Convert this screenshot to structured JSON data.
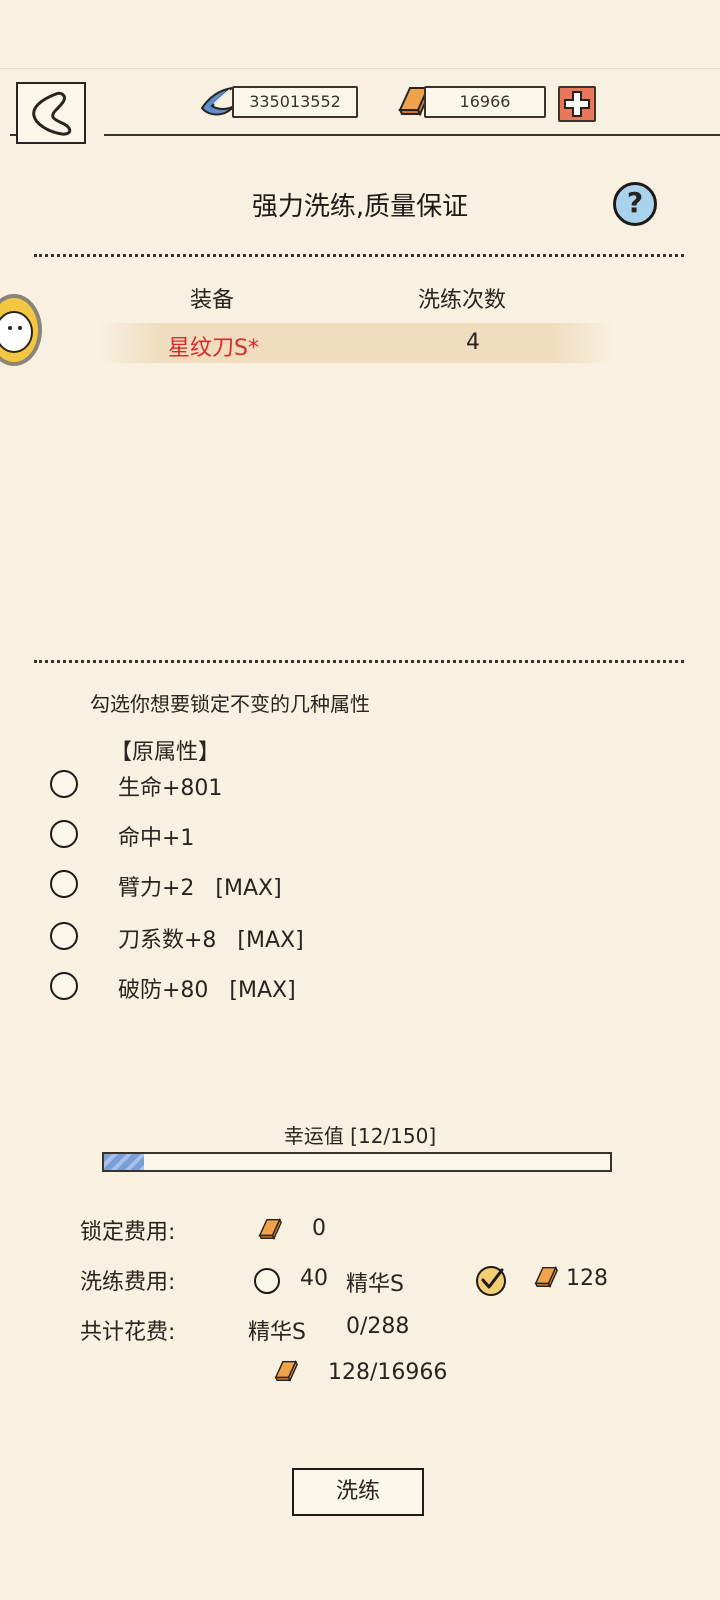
{
  "header": {
    "silver_amount": "335013552",
    "gold_amount": "16966",
    "add_icon": "plus-icon",
    "back_icon": "back-icon"
  },
  "title": "强力洗练,质量保证",
  "help_label": "?",
  "table": {
    "columns": [
      "装备",
      "洗练次数"
    ],
    "rows": [
      {
        "name": "星纹刀S*",
        "count": "4",
        "name_color": "#d62b2b"
      }
    ]
  },
  "lock": {
    "hint": "勾选你想要锁定不变的几种属性",
    "section_label": "【原属性】",
    "attributes": [
      {
        "label": "生命+801",
        "checked": false
      },
      {
        "label": "命中+1",
        "checked": false
      },
      {
        "label": "臂力+2   [MAX]",
        "checked": false
      },
      {
        "label": "刀系数+8   [MAX]",
        "checked": false
      },
      {
        "label": "破防+80   [MAX]",
        "checked": false
      }
    ]
  },
  "luck": {
    "label": "幸运值 [12/150]",
    "current": 12,
    "max": 150
  },
  "costs": {
    "lock_label": "锁定费用:",
    "lock_value": "0",
    "refine_label": "洗练费用:",
    "refine_option1_value": "40",
    "refine_option1_unit": "精华S",
    "refine_option2_value": "128",
    "refine_option2_selected": true,
    "total_label": "共计花费:",
    "total_essence_unit": "精华S",
    "total_essence_value": "0/288",
    "total_gold_value": "128/16966"
  },
  "action_button": "洗练",
  "colors": {
    "background": "#f8f1e1",
    "item_name": "#d62b2b",
    "plus_button": "#e8765a",
    "help_button": "#a9d3ec",
    "luck_fill": "#7a9ed6"
  }
}
